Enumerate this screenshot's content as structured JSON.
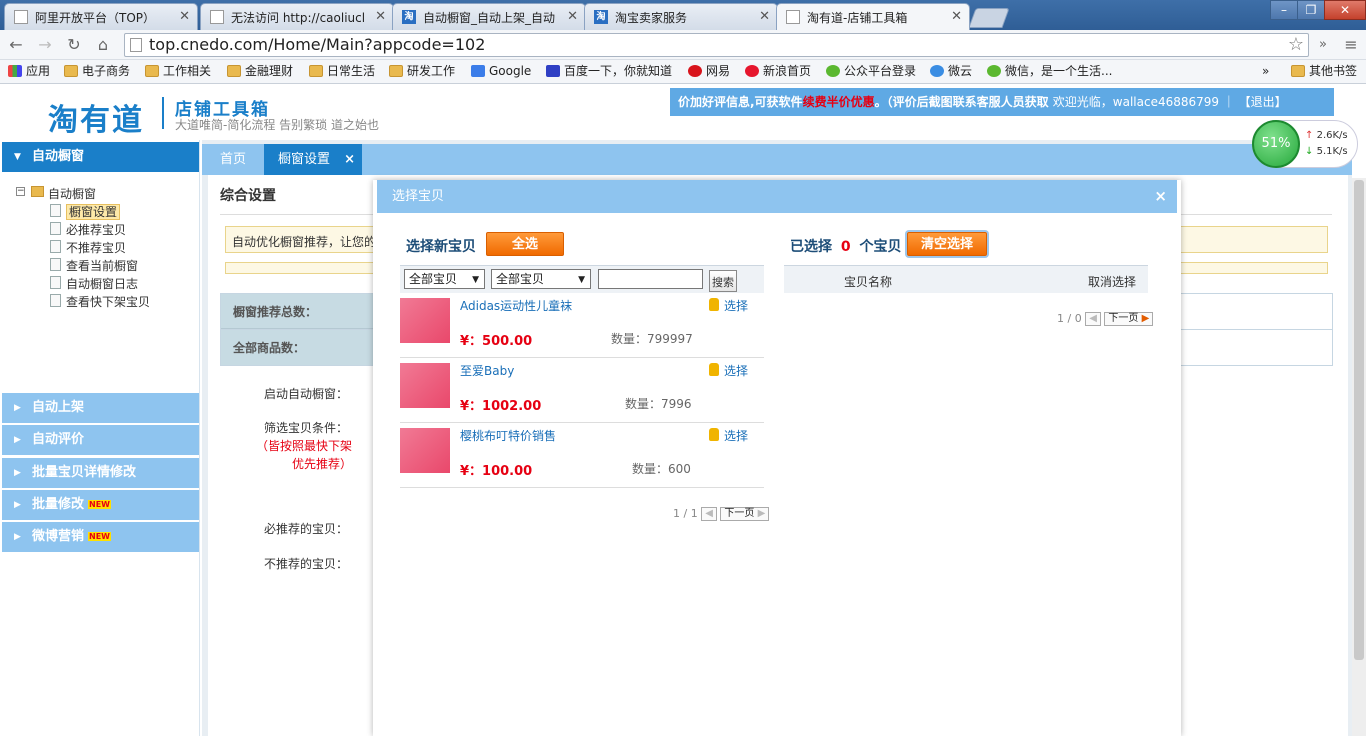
{
  "browser": {
    "tabs": [
      {
        "title": "阿里开放平台（TOP）"
      },
      {
        "title": "无法访问 http://caoliucl"
      },
      {
        "title": "自动橱窗_自动上架_自动"
      },
      {
        "title": "淘宝卖家服务"
      },
      {
        "title": "淘有道-店铺工具箱"
      }
    ],
    "url": "top.cnedo.com/Home/Main?appcode=102",
    "bookmarks": [
      "应用",
      "电子商务",
      "工作相关",
      "金融理财",
      "日常生活",
      "研发工作",
      "Google",
      "百度一下，你就知道",
      "网易",
      "新浪首页",
      "公众平台登录",
      "微云",
      "微信，是一个生活...",
      "»",
      "其他书签"
    ]
  },
  "header": {
    "logo": "淘有道",
    "logo_sub": "店铺工具箱",
    "slogan": "大道唯简-简化流程 告别繁琐 道之始也",
    "notice_a": "价加好评信息,可获软件",
    "notice_red": "续费半价优惠",
    "notice_b": "。（评价后截图联系客服人员获取",
    "welcome": "欢迎光临，wallace46886799 ｜ 【退出】"
  },
  "speed": {
    "percent": "51%",
    "up": "2.6K/s",
    "down": "5.1K/s"
  },
  "sidebar": {
    "main_section": "自动橱窗",
    "tree_root": "自动橱窗",
    "tree_items": [
      "橱窗设置",
      "必推荐宝贝",
      "不推荐宝贝",
      "查看当前橱窗",
      "自动橱窗日志",
      "查看快下架宝贝"
    ],
    "sections": [
      "自动上架",
      "自动评价",
      "批量宝贝详情修改",
      "批量修改",
      "微博营销"
    ],
    "new_badge": "NEW"
  },
  "content": {
    "tabs": [
      "首页",
      "橱窗设置"
    ],
    "tab_close": "×",
    "section_title": "综合设置",
    "notice": "自动优化橱窗推荐，让您的",
    "stat_total": "橱窗推荐总数：",
    "stat_all": "全部商品数：",
    "label_start": "启动自动橱窗：",
    "label_filter": "筛选宝贝条件：",
    "filter_hint_1": "（皆按照最快下架",
    "filter_hint_2": "优先推荐）",
    "label_must": "必推荐的宝贝：",
    "label_not": "不推荐的宝贝："
  },
  "modal": {
    "title": "选择宝贝",
    "close": "×",
    "left_title": "选择新宝贝",
    "select_all": "全选",
    "filter1": "全部宝贝",
    "filter2": "全部宝贝",
    "search_placeholder": "",
    "search_btn": "搜索",
    "products": [
      {
        "name": "Adidas运动性儿童袜",
        "price": "¥：500.00",
        "qty": "数量：799997",
        "action": "选择"
      },
      {
        "name": "至爱Baby",
        "price": "¥：1002.00",
        "qty": "数量：7996",
        "action": "选择"
      },
      {
        "name": "樱桃布叮特价销售",
        "price": "¥：100.00",
        "qty": "数量：600",
        "action": "选择"
      }
    ],
    "left_pager": "1 / 1",
    "left_next": "下一页",
    "right_title_a": "已选择",
    "right_count": "0",
    "right_title_b": "个宝贝",
    "clear_btn": "清空选择",
    "col_name": "宝贝名称",
    "col_cancel": "取消选择",
    "right_pager": "1 / 0",
    "right_next": "下一页"
  }
}
